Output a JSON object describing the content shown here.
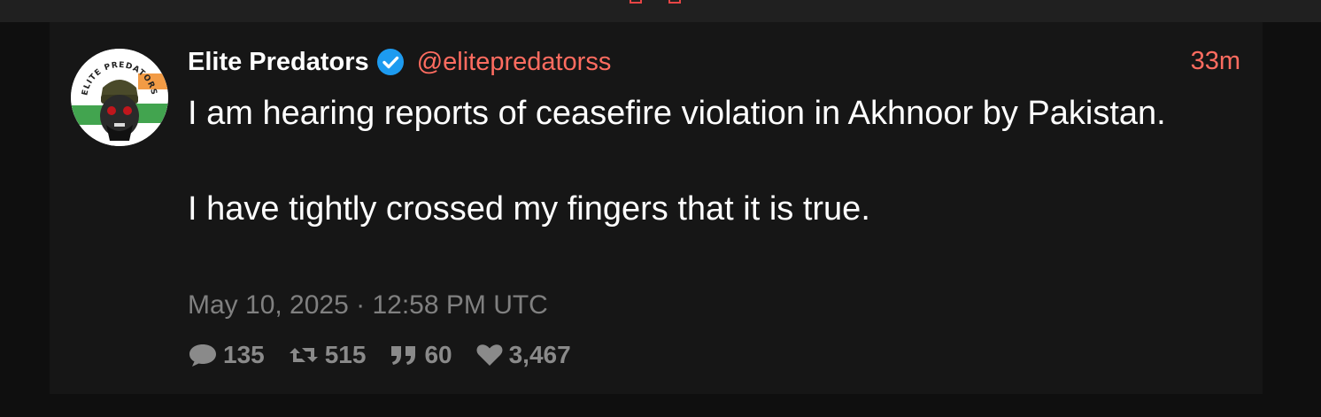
{
  "colors": {
    "background": "#0f0f0f",
    "card": "#161616",
    "accent": "#ff6c60",
    "text": "#ffffff",
    "muted": "#808080",
    "verified": "#1d9bf0"
  },
  "tweet": {
    "avatar_text": "ELITE PREDATORS",
    "fullname": "Elite Predators",
    "verified_icon": "verified-badge-icon",
    "username": "@elitepredatorss",
    "time": "33m",
    "content_lines": [
      "I am hearing reports of ceasefire violation in Akhnoor by Pakistan.",
      "I have tightly crossed my fingers that it is true."
    ],
    "published": "May 10, 2025 · 12:58 PM UTC",
    "stats": {
      "comments": "135",
      "retweets": "515",
      "quotes": "60",
      "likes": "3,467"
    },
    "stat_icons": {
      "comments": "comment-icon",
      "retweets": "retweet-icon",
      "quotes": "quote-icon",
      "likes": "heart-icon"
    }
  }
}
